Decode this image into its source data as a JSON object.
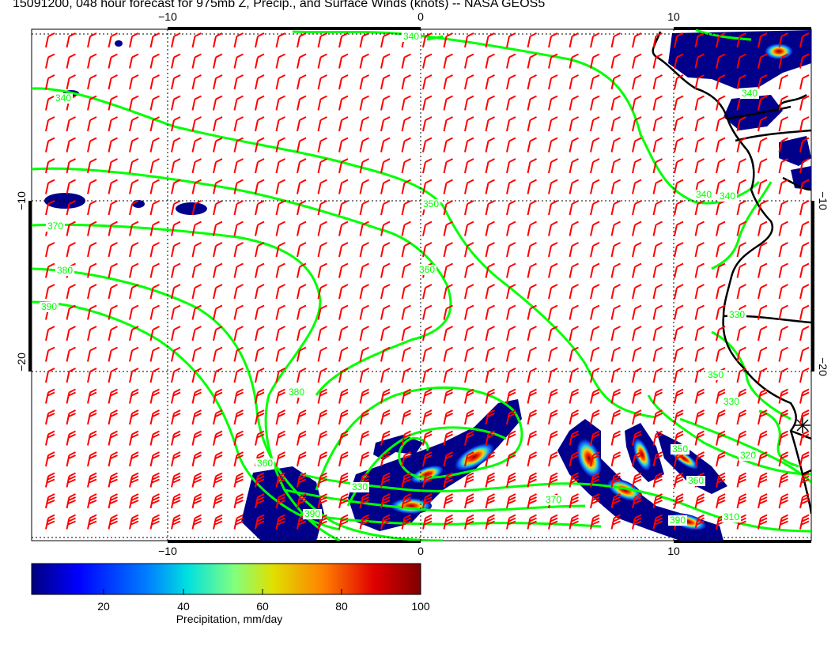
{
  "title": "15091200, 048 hour forecast for 975mb Z, Precip., and Surface Winds (knots) -- NASA GEOS5",
  "map": {
    "x_ticks_top": [
      "−10",
      "0",
      "10"
    ],
    "x_ticks_bottom": [
      "−10",
      "0",
      "10"
    ],
    "y_ticks_left": [
      "−10",
      "−20"
    ],
    "y_ticks_right": [
      "−10",
      "−20"
    ],
    "contour_labels": [
      "340",
      "340",
      "340",
      "340",
      "350",
      "360",
      "370",
      "380",
      "390",
      "350",
      "330",
      "330",
      "350",
      "360",
      "370",
      "390",
      "320",
      "310",
      "390",
      "380",
      "360",
      "340",
      "330"
    ],
    "colors": {
      "contour": "#00ff00",
      "wind_barbs": "#ff0000",
      "coastline": "#000000",
      "grid": "#000000"
    }
  },
  "colorbar": {
    "ticks": [
      "20",
      "40",
      "60",
      "80",
      "100"
    ],
    "label": "Precipitation, mm/day",
    "colors": [
      "#00007f",
      "#0000ff",
      "#007fff",
      "#00ffff",
      "#7fff7f",
      "#ffff00",
      "#ff7f00",
      "#ff0000",
      "#7f0000"
    ]
  }
}
